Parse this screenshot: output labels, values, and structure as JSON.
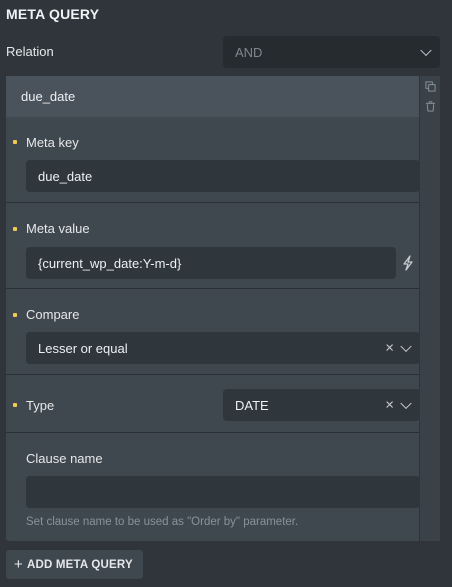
{
  "section": {
    "title": "META QUERY"
  },
  "relation": {
    "label": "Relation",
    "value": "AND"
  },
  "clause": {
    "header": "due_date",
    "meta_key": {
      "label": "Meta key",
      "value": "due_date"
    },
    "meta_value": {
      "label": "Meta value",
      "value": "{current_wp_date:Y-m-d}"
    },
    "compare": {
      "label": "Compare",
      "value": "Lesser or equal"
    },
    "type": {
      "label": "Type",
      "value": "DATE"
    },
    "clause_name": {
      "label": "Clause name",
      "value": "",
      "hint": "Set clause name to be used as \"Order by\" parameter."
    }
  },
  "add_button": {
    "label": "ADD META QUERY"
  },
  "colors": {
    "background": "#2f353b",
    "panel": "#3f474f",
    "input": "#2f363c",
    "required_dot": "#f2c94c"
  },
  "icons": {
    "duplicate": "copy-icon",
    "delete": "trash-icon",
    "dynamic": "bolt-icon",
    "clear": "close-icon",
    "dropdown": "chevron-down-icon",
    "add": "plus-icon"
  }
}
